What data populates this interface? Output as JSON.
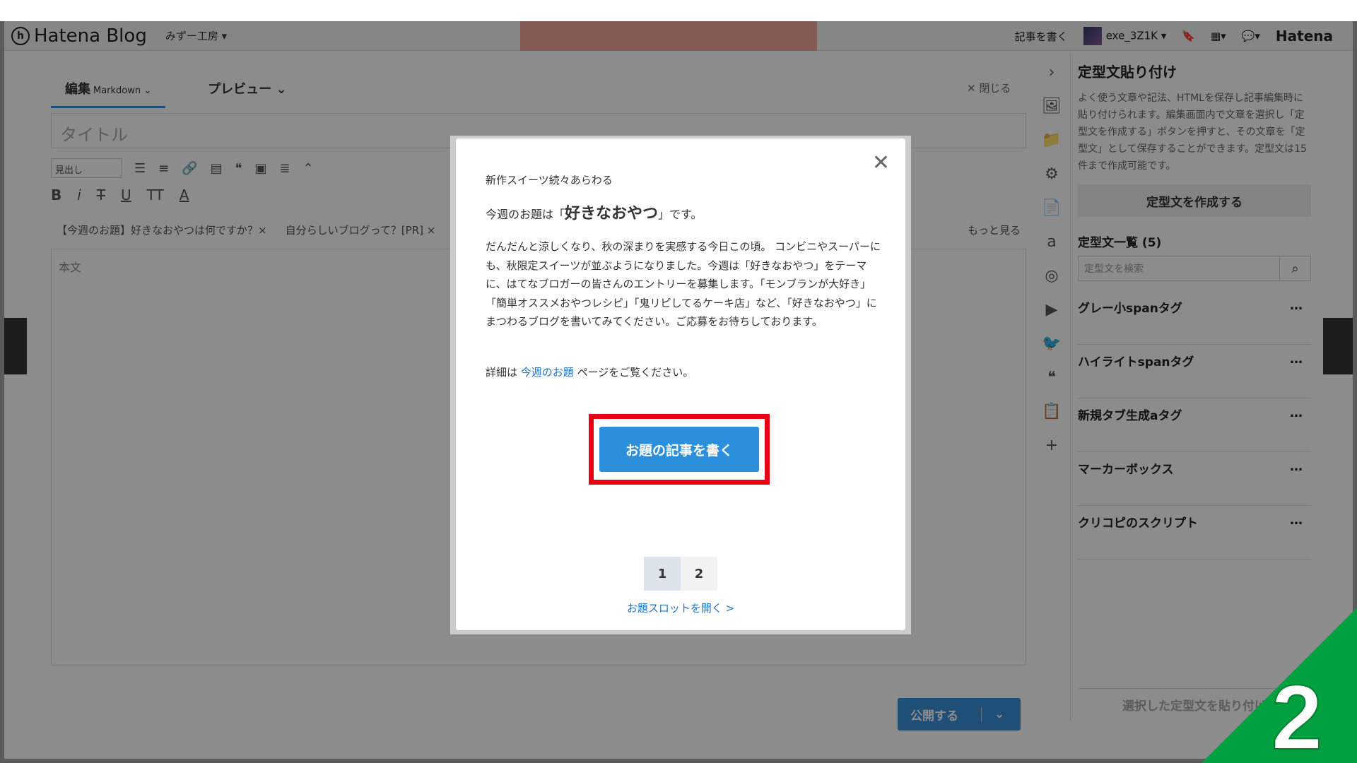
{
  "header": {
    "logo_mark": "h",
    "logo_text": "Hatena Blog",
    "blog_name": "みずー工房 ▾",
    "write_link": "記事を書く",
    "username": "exe_3Z1K ▾",
    "brand": "Hatena"
  },
  "editor": {
    "tabs": [
      {
        "label": "編集",
        "sub": "Markdown ⌄"
      },
      {
        "label": "プレビュー ⌄",
        "sub": ""
      }
    ],
    "close_label": "✕ 閉じる",
    "title_placeholder": "タイトル",
    "heading_select": "見出し",
    "tags": [
      "【今週のお題】好きなおやつは何ですか？×",
      "自分らしいブログって？[PR] ×"
    ],
    "more_label": "もっと見る",
    "body_placeholder": "本文",
    "publish_label": "公開する",
    "publish_arrow": "⌄"
  },
  "right_panel": {
    "title": "定型文貼り付け",
    "description": "よく使う文章や記法、HTMLを保存し記事編集時に貼り付けられます。編集画面内で文章を選択し「定型文を作成する」ボタンを押すと、その文章を「定型文」として保存することができます。定型文は15件まで作成可能です。",
    "create_button": "定型文を作成する",
    "list_title": "定型文一覧 (5)",
    "search_placeholder": "定型文を検索",
    "items": [
      "グレー小spanタグ",
      "ハイライトspanタグ",
      "新規タブ生成aタグ",
      "マーカーボックス",
      "クリコピのスクリプト"
    ],
    "item_menu": "…",
    "apply_button": "選択した定型文を貼り付け"
  },
  "modal": {
    "subtitle": "新作スイーツ続々あらわる",
    "topic_prefix": "今週のお題は「",
    "topic": "好きなおやつ",
    "topic_suffix": "」です。",
    "description": "だんだんと涼しくなり、秋の深まりを実感する今日この頃。 コンビニやスーパーにも、秋限定スイーツが並ぶようになりました。今週は「好きなおやつ」をテーマに、はてなブロガーの皆さんのエントリーを募集します。「モンブランが大好き」「簡単オススメおやつレシピ」「鬼リピしてるケーキ店」など、「好きなおやつ」にまつわるブログを書いてみてください。ご応募をお待ちしております。",
    "detail_prefix": "詳細は ",
    "detail_link": "今週のお題",
    "detail_suffix": " ページをご覧ください。",
    "cta_button": "お題の記事を書く",
    "pages": [
      "1",
      "2"
    ],
    "slot_link": "お題スロットを開く >",
    "close_glyph": "✕"
  },
  "step_number": "2",
  "colors": {
    "accent": "#2b8fdc",
    "highlight_frame": "#e60012",
    "step_badge": "#00a040"
  }
}
